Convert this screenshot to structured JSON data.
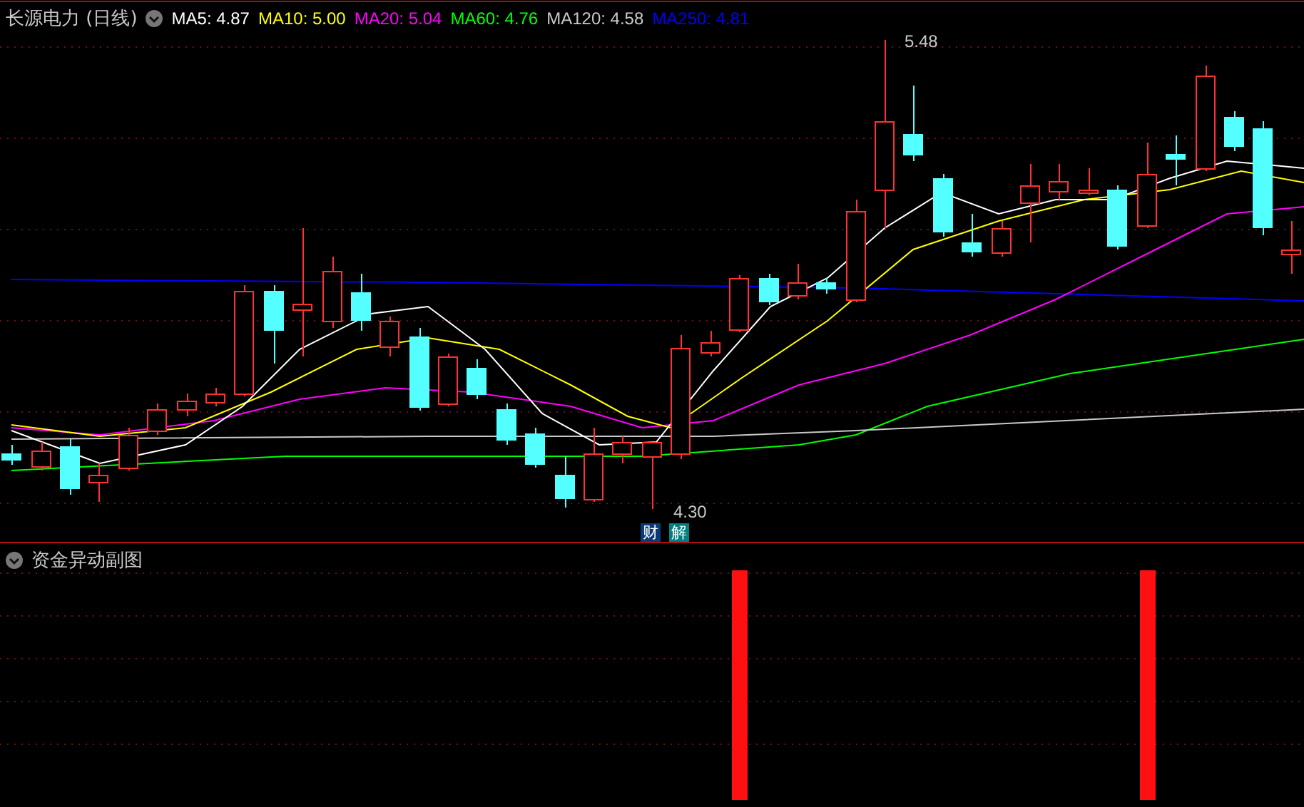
{
  "main_chart": {
    "title": "长源电力 (日线)",
    "indicators": [
      {
        "label": "MA5: 4.87",
        "color": "#ffffff"
      },
      {
        "label": "MA10: 5.00",
        "color": "#ffff00"
      },
      {
        "label": "MA20: 5.04",
        "color": "#ff00ff"
      },
      {
        "label": "MA60: 4.76",
        "color": "#00ff00"
      },
      {
        "label": "MA120: 4.58",
        "color": "#c8c8c8"
      },
      {
        "label": "MA250: 4.81",
        "color": "#0000ff"
      }
    ],
    "high_label": "5.48",
    "low_label": "4.30",
    "badges": [
      {
        "text": "财",
        "color": "#0a3a78"
      },
      {
        "text": "解",
        "color": "#008080"
      }
    ]
  },
  "sub_chart": {
    "title": "资金异动副图"
  }
}
